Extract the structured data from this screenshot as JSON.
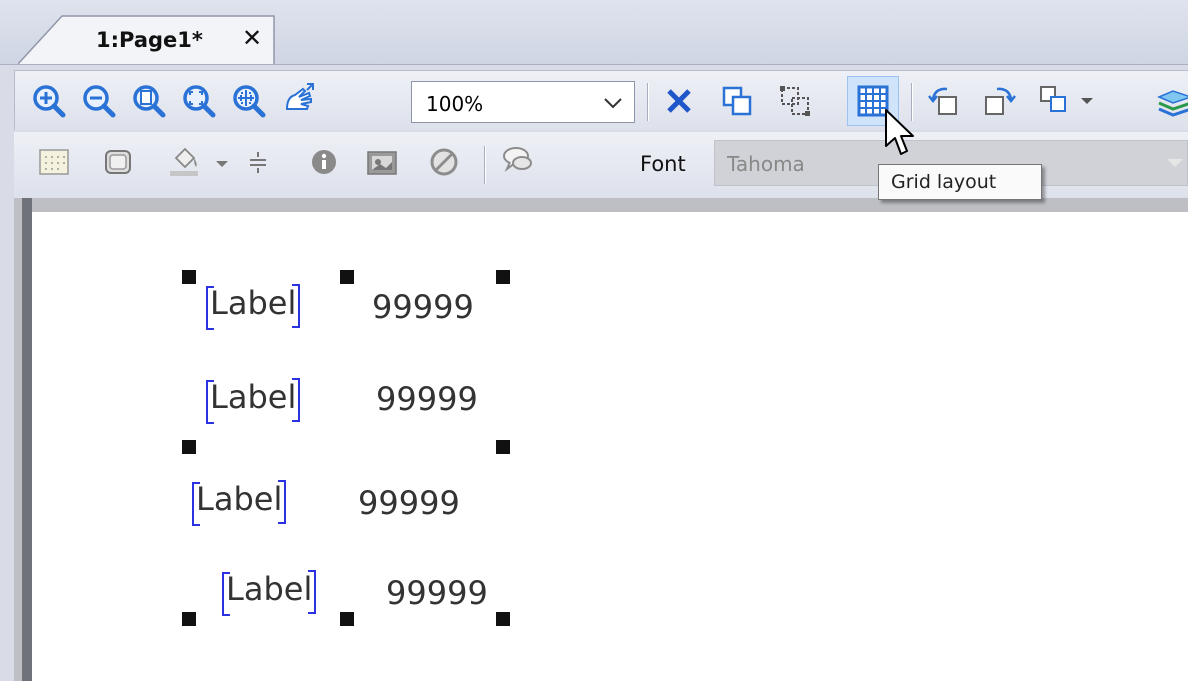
{
  "tab": {
    "title": "1:Page1*",
    "close": "✕"
  },
  "toolbar1": {
    "icons": [
      "zoom-in-icon",
      "zoom-out-icon",
      "zoom-page-icon",
      "zoom-fit-icon",
      "zoom-selection-icon",
      "pan-icon"
    ],
    "zoom_value": "100%",
    "after": [
      "delete-icon",
      "group-icon",
      "ungroup-icon",
      "grid-layout-icon",
      "rotate-left-icon",
      "rotate-right-icon",
      "arrange-icon",
      "layers-icon"
    ]
  },
  "toolbar2": {
    "font_label": "Font",
    "font_value": "Tahoma"
  },
  "tooltip": {
    "text": "Grid layout"
  },
  "canvas": {
    "rows": [
      {
        "label": "Label",
        "value": "99999"
      },
      {
        "label": "Label",
        "value": "99999"
      },
      {
        "label": "Label",
        "value": "99999"
      },
      {
        "label": "Label",
        "value": "99999"
      }
    ]
  },
  "colors": {
    "accent": "#2a72d6",
    "bracket": "#2933e0",
    "delete": "#1f56c9"
  }
}
